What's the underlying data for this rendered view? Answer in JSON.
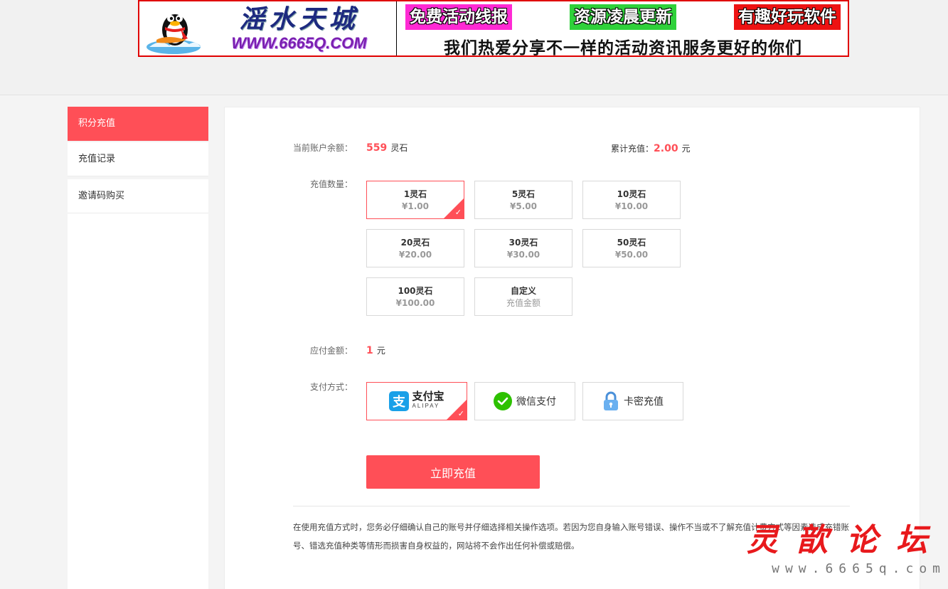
{
  "banner": {
    "site_name": "滛水天城",
    "site_url": "WWW.6665Q.COM",
    "tags": [
      "免费活动线报",
      "资源凌晨更新",
      "有趣好玩软件"
    ],
    "slogan": "我们热爱分享不一样的活动资讯服务更好的你们"
  },
  "sidebar": {
    "items": [
      {
        "label": "积分充值",
        "active": true
      },
      {
        "label": "充值记录",
        "active": false
      },
      {
        "label": "邀请码购买",
        "active": false
      }
    ]
  },
  "account": {
    "balance_label": "当前账户余额：",
    "balance_value": "559",
    "balance_unit": "灵石",
    "total_label": "累计充值：",
    "total_value": "2.00",
    "total_unit": "元"
  },
  "recharge": {
    "label": "充值数量：",
    "options": [
      {
        "name": "1灵石",
        "price": "¥1.00",
        "selected": true
      },
      {
        "name": "5灵石",
        "price": "¥5.00"
      },
      {
        "name": "10灵石",
        "price": "¥10.00"
      },
      {
        "name": "20灵石",
        "price": "¥20.00"
      },
      {
        "name": "30灵石",
        "price": "¥30.00"
      },
      {
        "name": "50灵石",
        "price": "¥50.00"
      },
      {
        "name": "100灵石",
        "price": "¥100.00"
      },
      {
        "name": "自定义",
        "price": "充值金额"
      }
    ]
  },
  "payable": {
    "label": "应付金额：",
    "value": "1",
    "unit": "元"
  },
  "payment": {
    "label": "支付方式：",
    "methods": [
      {
        "name": "支付宝",
        "sub": "ALIPAY",
        "icon": "alipay-icon",
        "selected": true
      },
      {
        "name": "微信支付",
        "icon": "wechat-icon"
      },
      {
        "name": "卡密充值",
        "icon": "lock-icon"
      }
    ]
  },
  "submit_label": "立即充值",
  "notice": "在使用充值方式时，您务必仔细确认自己的账号并仔细选择相关操作选项。若因为您自身输入账号错误、操作不当或不了解充值计费方式等因素造成充错账号、错选充值种类等情形而损害自身权益的，网站将不会作出任何补偿或赔偿。",
  "watermark": {
    "title": "灵歆论坛",
    "url": "www.6665q.com"
  },
  "colors": {
    "accent": "#ff4f57",
    "alipay": "#1aa0e8",
    "wechat": "#2dc100",
    "lock": "#4a90d9"
  }
}
